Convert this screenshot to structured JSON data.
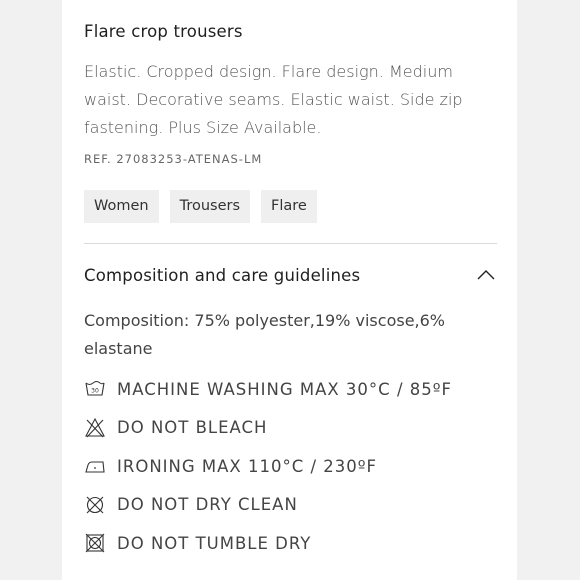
{
  "product": {
    "title": "Flare crop trousers",
    "description": "Elastic. Cropped design. Flare design. Medium waist. Decorative seams. Elastic waist. Side zip fastening. Plus Size Available.",
    "ref": "REF. 27083253-ATENAS-LM"
  },
  "tags": [
    "Women",
    "Trousers",
    "Flare"
  ],
  "accordion": {
    "title": "Composition and care guidelines",
    "state_icon": "chevron-up-icon",
    "composition": "Composition: 75% polyester,19% viscose,6% elastane",
    "care": [
      {
        "icon": "machine-wash-30-icon",
        "icon_text": "30",
        "label": "MACHINE WASHING MAX 30°C / 85ºF"
      },
      {
        "icon": "do-not-bleach-icon",
        "label": "DO NOT BLEACH"
      },
      {
        "icon": "iron-icon",
        "label": "IRONING MAX 110°C / 230ºF"
      },
      {
        "icon": "do-not-dry-clean-icon",
        "label": "DO NOT DRY CLEAN"
      },
      {
        "icon": "do-not-tumble-dry-icon",
        "label": "DO NOT TUMBLE DRY"
      }
    ]
  }
}
